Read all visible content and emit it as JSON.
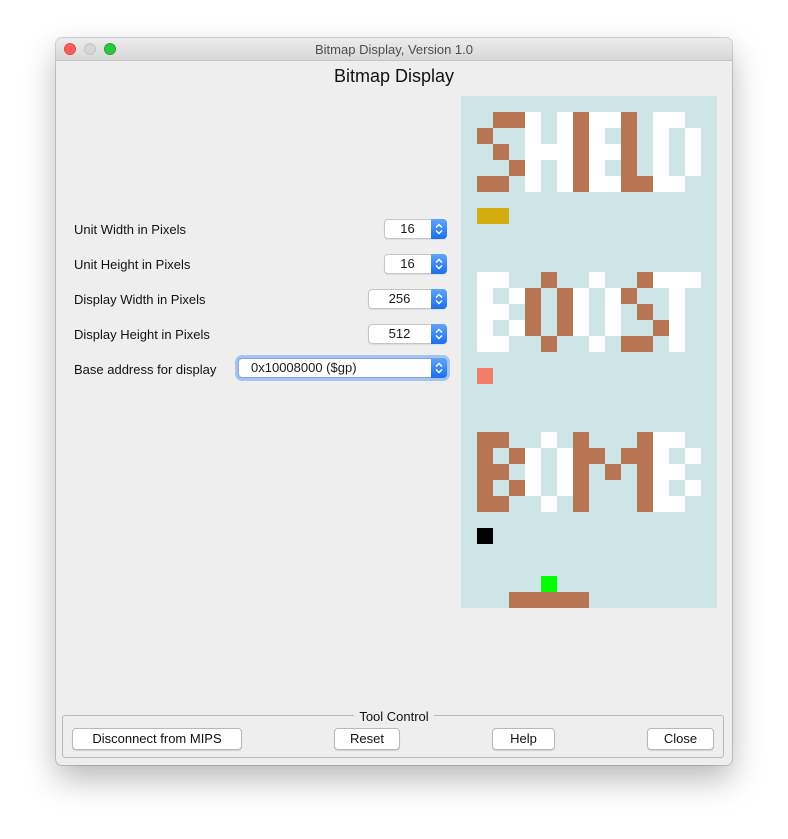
{
  "window": {
    "title": "Bitmap Display, Version 1.0",
    "heading": "Bitmap Display"
  },
  "settings": {
    "unit_width": {
      "label": "Unit Width in Pixels",
      "value": "16"
    },
    "unit_height": {
      "label": "Unit Height in Pixels",
      "value": "16"
    },
    "display_width": {
      "label": "Display Width in Pixels",
      "value": "256"
    },
    "display_height": {
      "label": "Display Height in Pixels",
      "value": "512"
    },
    "base_address": {
      "label": "Base address for display",
      "value": "0x10008000 ($gp)"
    }
  },
  "bitmap": {
    "background": "#cde5e7",
    "palette": {
      "brown": "#b97455",
      "white": "#ffffff",
      "gold": "#d4ac0d",
      "salmon": "#f47c6a",
      "black": "#000000",
      "green": "#00ff00",
      "blue_accent": "#1a6ff1"
    },
    "sprites": [
      "SHIELD",
      "BOOST",
      "BOMB",
      "player",
      "paddle"
    ]
  },
  "tool_control": {
    "title": "Tool Control",
    "buttons": {
      "disconnect": "Disconnect from MIPS",
      "reset": "Reset",
      "help": "Help",
      "close": "Close"
    }
  }
}
